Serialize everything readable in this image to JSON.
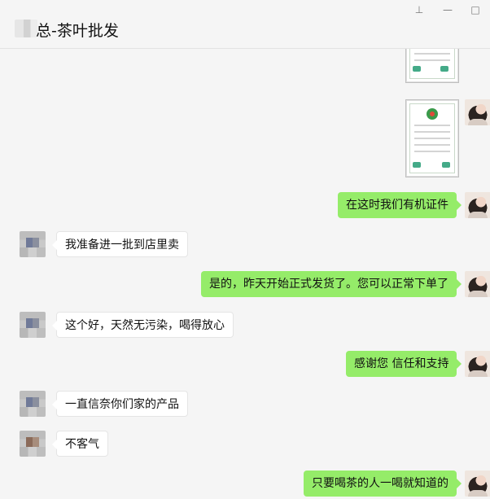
{
  "window": {
    "title": "总-茶叶批发",
    "pin_label": "⊥",
    "minimize_label": "—",
    "maximize_label": "□"
  },
  "messages": [
    {
      "side": "out",
      "kind": "image",
      "desc": "certificate-image"
    },
    {
      "side": "out",
      "kind": "image",
      "desc": "certificate-image"
    },
    {
      "side": "out",
      "kind": "text",
      "text": "在这时我们有机证件"
    },
    {
      "side": "in",
      "kind": "text",
      "text": "我准备进一批到店里卖"
    },
    {
      "side": "out",
      "kind": "text",
      "text": "是的，昨天开始正式发货了。您可以正常下单了"
    },
    {
      "side": "in",
      "kind": "text",
      "text": "这个好，天然无污染，喝得放心"
    },
    {
      "side": "out",
      "kind": "text",
      "text": "感谢您 信任和支持"
    },
    {
      "side": "in",
      "kind": "text",
      "text": "一直信奈你们家的产品"
    },
    {
      "side": "in",
      "kind": "text",
      "text": "不客气"
    },
    {
      "side": "out",
      "kind": "text",
      "text": "只要喝茶的人一喝就知道的"
    }
  ],
  "colors": {
    "background": "#f5f5f5",
    "outgoing_bubble": "#95ec69",
    "incoming_bubble": "#ffffff"
  }
}
